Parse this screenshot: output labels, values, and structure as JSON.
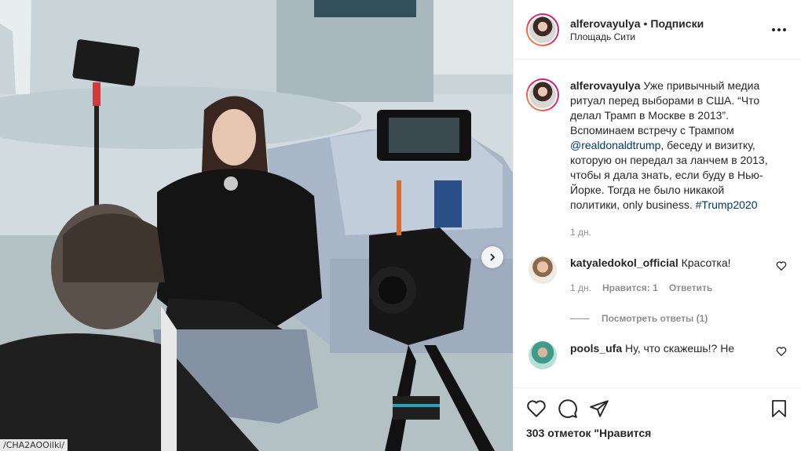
{
  "post": {
    "url_fragment": "/CHA2AOOilki/",
    "next_icon": "chevron-right-icon"
  },
  "header": {
    "username": "alferovayulya",
    "separator": "•",
    "follow_label": "Подписки",
    "location": "Площадь Сити",
    "more_icon": "more-horizontal-icon"
  },
  "caption": {
    "username": "alferovayulya",
    "text_before_mention": "Уже привычный медиа ритуал перед выборами в США. “Что делал Трамп в Москве в 2013”. Вспоминаем встречу с Трампом",
    "mention": "@realdonaldtrump",
    "text_after_mention": ", беседу и визитку, которую он передал за ланчем в 2013, чтобы я дала знать, если буду в Нью-Йорке. Тогда не было никакой политики, only business.",
    "hashtag": "#Trump2020",
    "time": "1 дн."
  },
  "comments": [
    {
      "username": "katyaledokol_official",
      "text": "Красотка!",
      "time": "1 дн.",
      "likes": "Нравится: 1",
      "reply_label": "Ответить",
      "view_replies": "Посмотреть ответы (1)"
    },
    {
      "username": "pools_ufa",
      "text": "Ну, что скажешь!? Не"
    }
  ],
  "actions": {
    "like_icon": "heart-icon",
    "comment_icon": "comment-icon",
    "share_icon": "paper-plane-icon",
    "save_icon": "bookmark-icon",
    "likes_text": "303 отметок \"Нравится"
  }
}
